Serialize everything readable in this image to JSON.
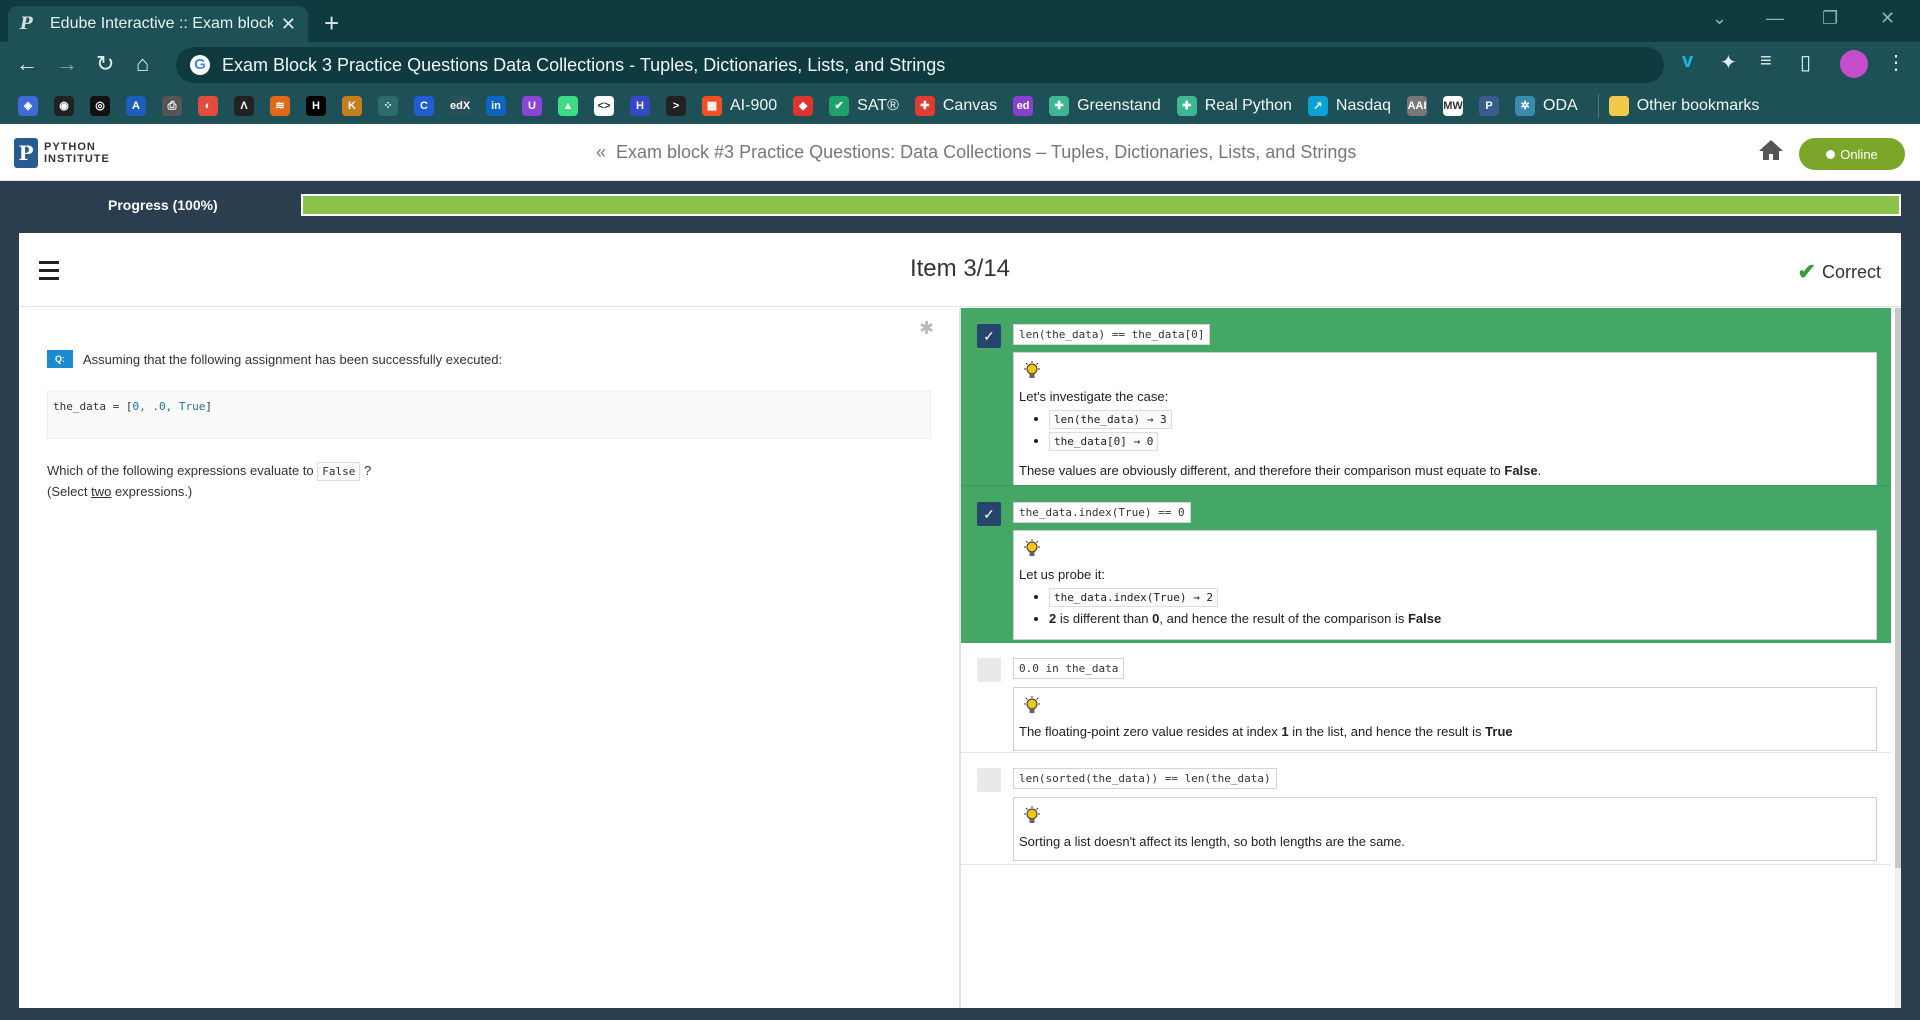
{
  "browser": {
    "tab_title": "Edube Interactive :: Exam block #",
    "tab_close": "✕",
    "new_tab": "+",
    "url": "Exam Block 3 Practice Questions Data Collections - Tuples, Dictionaries, Lists, and Strings",
    "bookmarks": [
      {
        "icon": "layers-icon",
        "label": "",
        "color": "#3d6ad6"
      },
      {
        "icon": "github-icon",
        "label": "",
        "color": "#222"
      },
      {
        "icon": "copilot-icon",
        "label": "",
        "color": "#111"
      },
      {
        "icon": "azure-icon",
        "label": "",
        "color": "#1b5fb8"
      },
      {
        "icon": "printer-icon",
        "label": "",
        "color": "#555"
      },
      {
        "icon": "swirl-icon",
        "label": "",
        "color": "#e24c3c"
      },
      {
        "icon": "anaconda-icon",
        "label": "",
        "color": "#222"
      },
      {
        "icon": "stripes-icon",
        "label": "",
        "color": "#e06a1b"
      },
      {
        "icon": "hackerrank-icon",
        "label": "",
        "color": "#000"
      },
      {
        "icon": "kaggle-icon",
        "label": "",
        "color": "#c47e1e"
      },
      {
        "icon": "dots-icon",
        "label": "",
        "color": "#2d6c6c"
      },
      {
        "icon": "coursera-icon",
        "label": "",
        "color": "#1f5ed2"
      },
      {
        "icon": "edx-icon",
        "label": "",
        "color": "#2b4f56"
      },
      {
        "icon": "linkedin-icon",
        "label": "",
        "color": "#0a66c2"
      },
      {
        "icon": "udemy-icon",
        "label": "",
        "color": "#8a45d6"
      },
      {
        "icon": "android-icon",
        "label": "",
        "color": "#3ddc84"
      },
      {
        "icon": "code-icon",
        "label": "",
        "color": "#fff"
      },
      {
        "icon": "h-icon",
        "label": "",
        "color": "#3449c4"
      },
      {
        "icon": "terminal-icon",
        "label": "",
        "color": "#222"
      },
      {
        "icon": "microsoft-icon",
        "label": "AI-900",
        "color": "#f25022"
      },
      {
        "icon": "shield-icon",
        "label": "",
        "color": "#e0322e"
      },
      {
        "icon": "sat-icon",
        "label": "SAT®",
        "color": "#1ca26a"
      },
      {
        "icon": "canvas-icon",
        "label": "Canvas",
        "color": "#e13c34"
      },
      {
        "icon": "ed-icon",
        "label": "",
        "color": "#8b3fd1"
      },
      {
        "icon": "slack-icon",
        "label": "Greenstand",
        "color": "#3eb891"
      },
      {
        "icon": "slack-icon",
        "label": "Real Python",
        "color": "#3eb891"
      },
      {
        "icon": "chart-icon",
        "label": "Nasdaq",
        "color": "#0aa3d6"
      },
      {
        "icon": "aai-icon",
        "label": "",
        "color": "#777"
      },
      {
        "icon": "mw-icon",
        "label": "",
        "color": "#fff"
      },
      {
        "icon": "python-icon",
        "label": "",
        "color": "#3a5c8c"
      },
      {
        "icon": "openai-icon",
        "label": "ODA",
        "color": "#3a8ab0"
      }
    ],
    "other_bookmarks": "Other bookmarks"
  },
  "site": {
    "logo_line1": "PYTHON",
    "logo_line2": "INSTITUTE",
    "breadcrumb": "Exam block #3 Practice Questions: Data Collections – Tuples, Dictionaries, Lists, and Strings",
    "online_label": "Online",
    "progress_label": "Progress (100%)",
    "progress_value": 1.0
  },
  "card": {
    "item_title": "Item 3/14",
    "status": "Correct"
  },
  "question": {
    "badge": "Q:",
    "prompt": "Assuming that the following assignment has been successfully executed:",
    "code_prefix": "the_data = [",
    "code_values": "0, .0, True",
    "code_suffix": "]",
    "which_prefix": "Which of the following expressions evaluate to",
    "which_code": "False",
    "which_suffix": "?",
    "select_prefix": "(Select",
    "select_emph": "two",
    "select_suffix": "expressions.)"
  },
  "options": [
    {
      "expr": "len(the_data) == the_data[0]",
      "selected": true,
      "intro": "Let's investigate the case:",
      "bullets": [
        "len(the_data) → 3",
        "the_data[0] → 0"
      ],
      "conclusion_prefix": "These values are obviously different, and therefore their comparison must equate to",
      "conclusion_bold": "False",
      "conclusion_suffix": "."
    },
    {
      "expr": "the_data.index(True) == 0",
      "selected": true,
      "intro": "Let us probe it:",
      "bullet_code": "the_data.index(True) → 2",
      "bullet2_a": "2",
      "bullet2_b": "is different than",
      "bullet2_c": "0",
      "bullet2_d": ", and hence the result of the comparison is",
      "bullet2_e": "False"
    },
    {
      "expr": "0.0 in the_data",
      "selected": false,
      "text_prefix": "The floating-point zero value resides at index",
      "text_bold1": "1",
      "text_mid": "in the list, and hence the result is",
      "text_bold2": "True"
    },
    {
      "expr": "len(sorted(the_data)) == len(the_data)",
      "selected": false,
      "text": "Sorting a list doesn't affect its length, so both lengths are the same."
    }
  ]
}
